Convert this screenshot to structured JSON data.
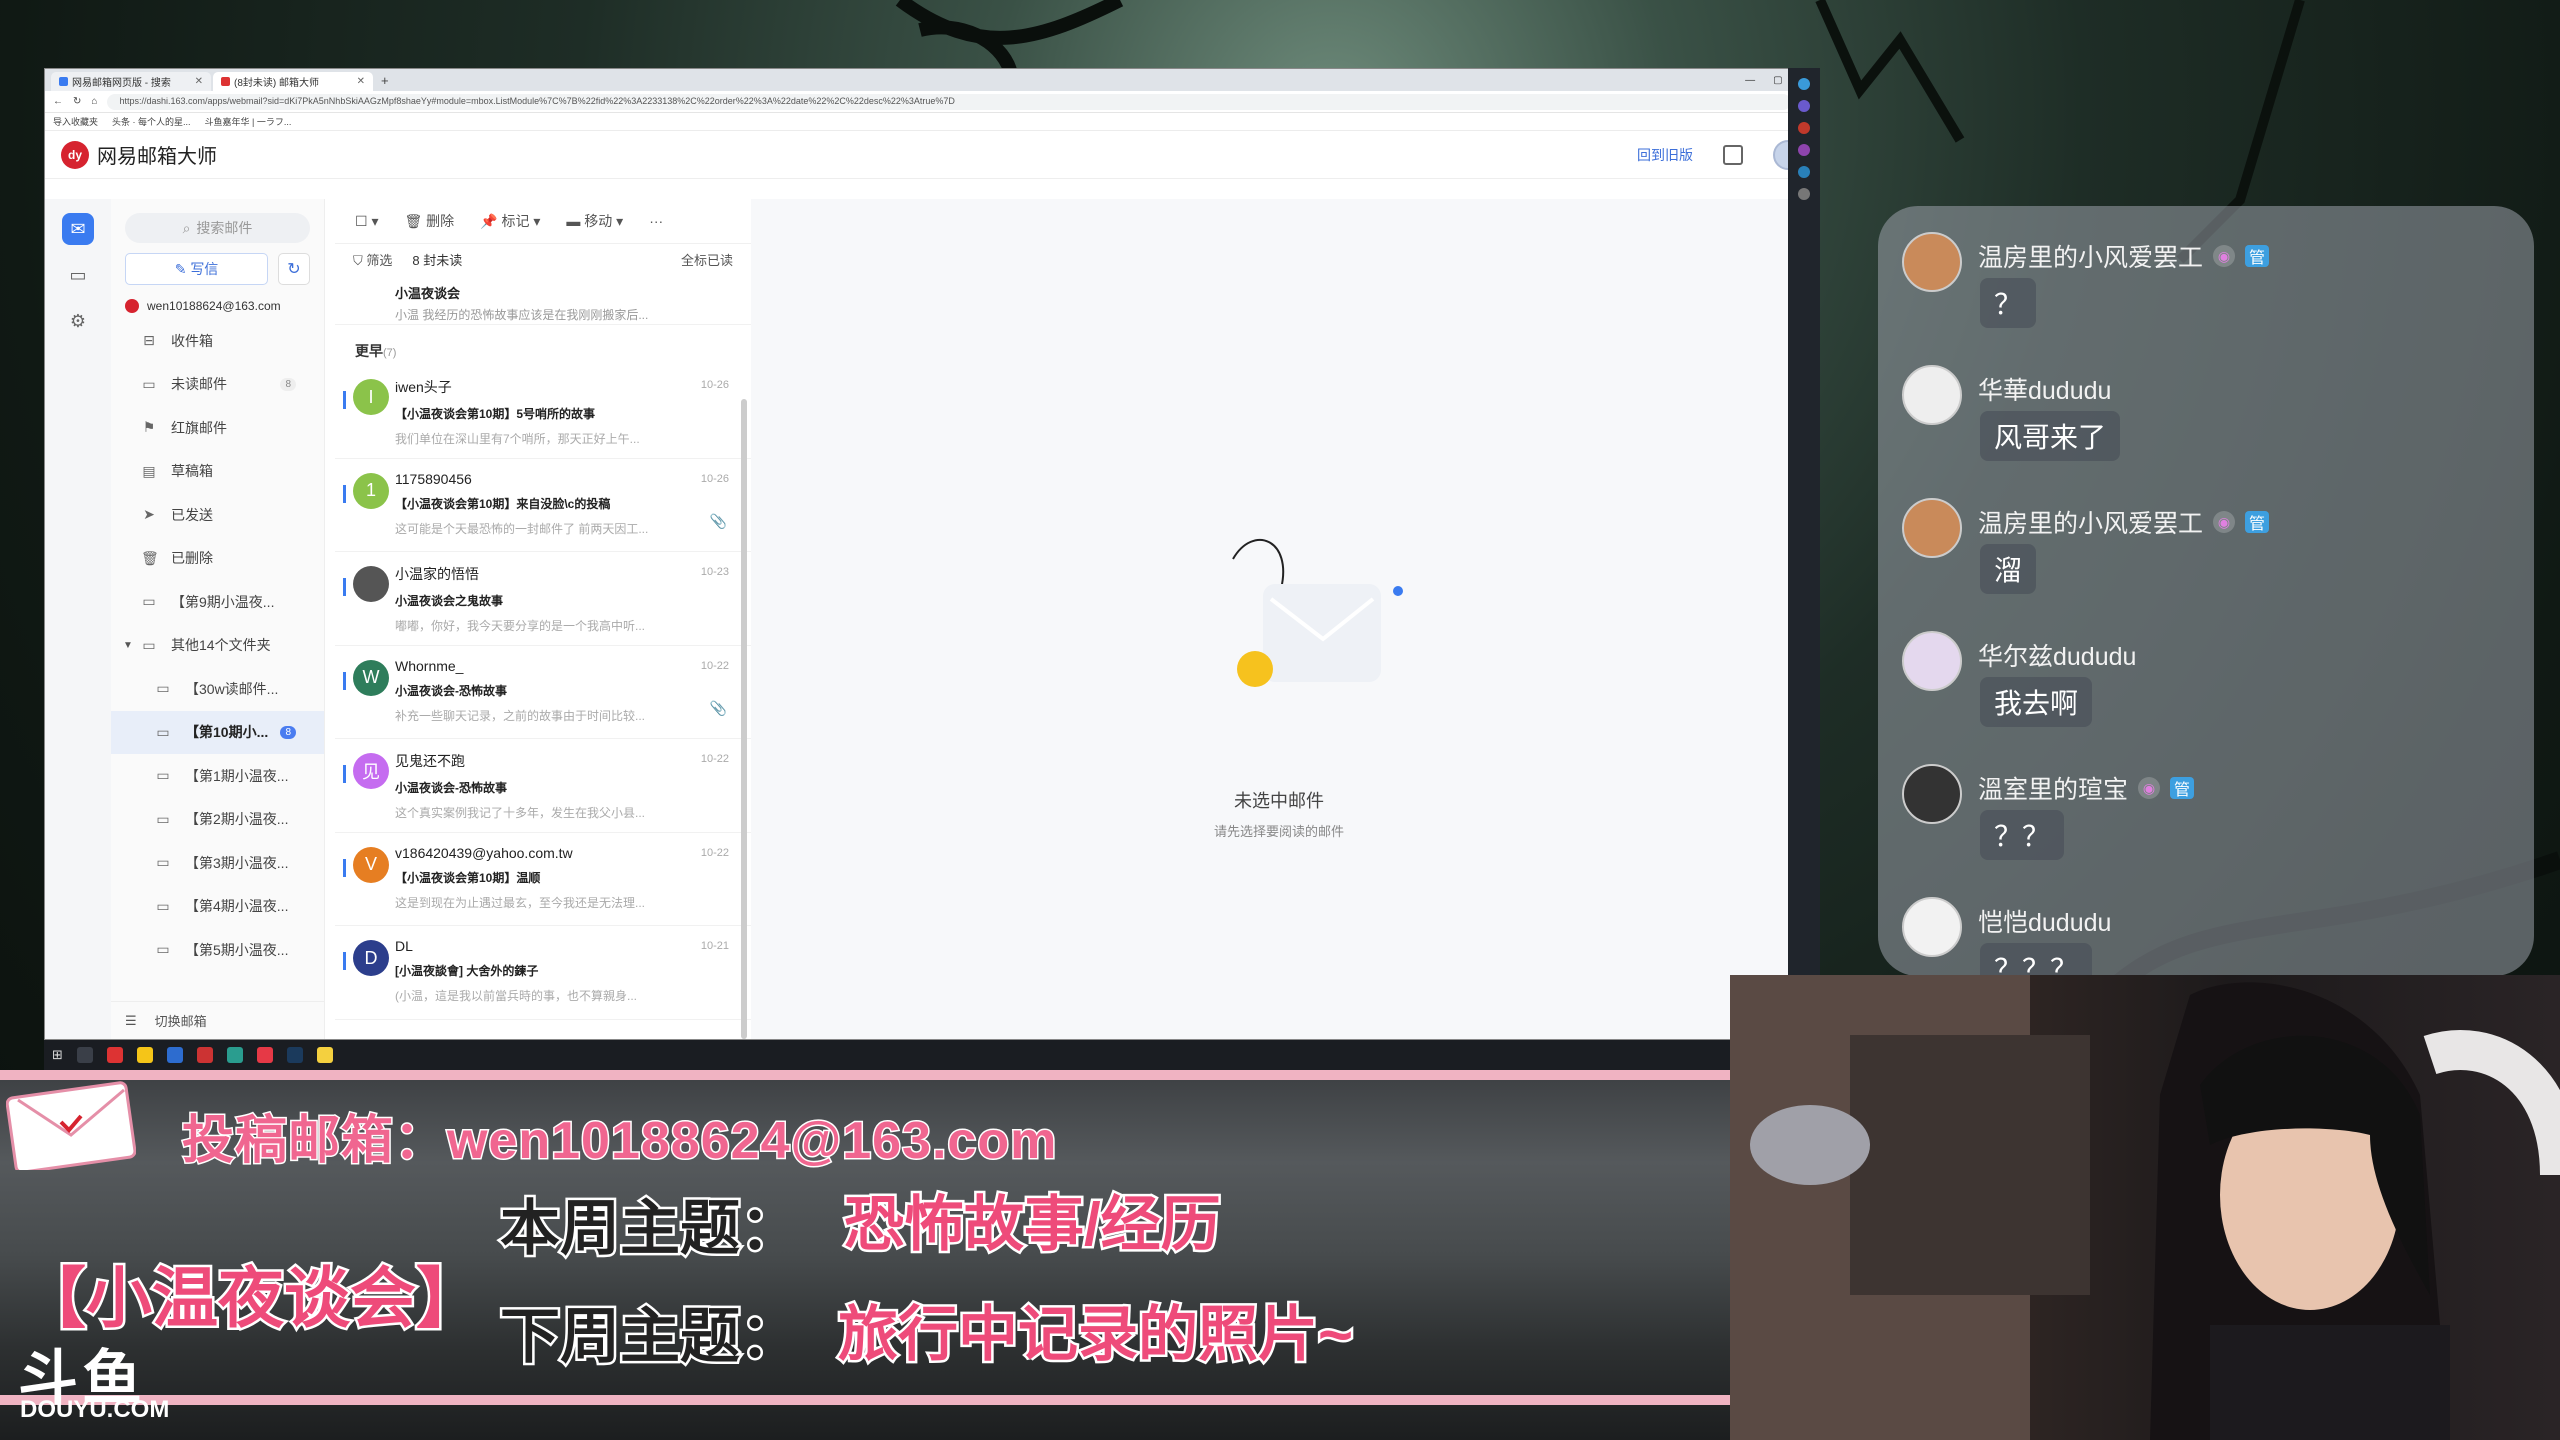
{
  "browser": {
    "tabs": [
      {
        "title": "网易邮箱网页版 - 搜索"
      },
      {
        "title": "(8封未读) 邮箱大师"
      }
    ],
    "new_tab": "+",
    "url": "https://dashi.163.com/apps/webmail?sid=dKi7PkA5nNhbSkiAAGzMpf8shaeYy#module=mbox.ListModule%7C%7B%22fid%22%3A2233138%2C%22order%22%3A%22date%22%2C%22desc%22%3Atrue%7D",
    "bookmarks": [
      "导入收藏夹",
      "头条 · 每个人的星...",
      "斗鱼嘉年华 | 一ラフ..."
    ]
  },
  "app": {
    "logo_text": "dy",
    "brand": "网易邮箱大师",
    "old_version_link": "回到旧版",
    "search_placeholder": "搜索邮件",
    "write_label": "写信",
    "account": "wen10188624@163.com",
    "folders": [
      {
        "label": "收件箱",
        "icon": "inbox-icon"
      },
      {
        "label": "未读邮件",
        "icon": "folder-icon",
        "count": "8"
      },
      {
        "label": "红旗邮件",
        "icon": "flag-icon"
      },
      {
        "label": "草稿箱",
        "icon": "draft-icon"
      },
      {
        "label": "已发送",
        "icon": "send-icon"
      },
      {
        "label": "已删除",
        "icon": "trash-icon"
      },
      {
        "label": "【第9期小温夜...",
        "icon": "folder-icon"
      },
      {
        "label": "其他14个文件夹",
        "icon": "folder-icon"
      },
      {
        "label": "【30w读邮件...",
        "icon": "folder-icon"
      },
      {
        "label": "【第10期小...",
        "icon": "folder-icon",
        "count": "8"
      },
      {
        "label": "【第1期小温夜...",
        "icon": "folder-icon"
      },
      {
        "label": "【第2期小温夜...",
        "icon": "folder-icon"
      },
      {
        "label": "【第3期小温夜...",
        "icon": "folder-icon"
      },
      {
        "label": "【第4期小温夜...",
        "icon": "folder-icon"
      },
      {
        "label": "【第5期小温夜...",
        "icon": "folder-icon"
      }
    ],
    "switch_account": "切换邮箱",
    "toolbar": {
      "delete": "删除",
      "mark": "标记",
      "move": "移动",
      "more": "···"
    },
    "filter": {
      "filter": "筛选",
      "unread": "8 封未读",
      "mark_all_read": "全标已读"
    },
    "peek_mail": {
      "subject": "小温夜谈会",
      "preview": "小温 我经历的恐怖故事应该是在我刚刚搬家后..."
    },
    "group_label": "更早",
    "group_count": "(7)",
    "mails": [
      {
        "initial": "I",
        "color": "#8bc34a",
        "from": "iwen头子",
        "date": "10-26",
        "subject": "【小温夜谈会第10期】5号哨所的故事",
        "preview": "我们单位在深山里有7个哨所，那天正好上午...",
        "attachment": false
      },
      {
        "initial": "1",
        "color": "#8bc34a",
        "from": "1175890456",
        "date": "10-26",
        "subject": "【小温夜谈会第10期】来自没脸\\c的投稿",
        "preview": "这可能是个天最恐怖的一封邮件了 前两天因工...",
        "attachment": true
      },
      {
        "initial": "",
        "color": "#555555",
        "from": "小温家的悟悟",
        "date": "10-23",
        "subject": "小温夜谈会之鬼故事",
        "preview": "嘟嘟，你好，我今天要分享的是一个我高中听...",
        "attachment": false
      },
      {
        "initial": "W",
        "color": "#2e7d5b",
        "from": "Whornme_",
        "date": "10-22",
        "subject": "小温夜谈会-恐怖故事",
        "preview": "补充一些聊天记录，之前的故事由于时间比较...",
        "attachment": true
      },
      {
        "initial": "见",
        "color": "#c56cf0",
        "from": "见鬼还不跑",
        "date": "10-22",
        "subject": "小温夜谈会-恐怖故事",
        "preview": "这个真实案例我记了十多年，发生在我父小县...",
        "attachment": false
      },
      {
        "initial": "V",
        "color": "#e67e22",
        "from": "v186420439@yahoo.com.tw",
        "date": "10-22",
        "subject": "【小温夜谈会第10期】温顺",
        "preview": "这是到现在为止遇过最玄，至今我还是无法理...",
        "attachment": false
      },
      {
        "initial": "D",
        "color": "#2c3e8c",
        "from": "DL",
        "date": "10-21",
        "subject": "[小温夜談會] 大舍外的鍊子",
        "preview": "(小温，這是我以前當兵時的事，也不算親身...",
        "attachment": false
      }
    ],
    "empty_title": "未选中邮件",
    "empty_subtitle": "请先选择要阅读的邮件"
  },
  "chat": {
    "messages": [
      {
        "user": "温房里的小风爱罢工",
        "badges": [
          "管"
        ],
        "text": "？"
      },
      {
        "user": "华華dududu",
        "badges": [],
        "text": "风哥来了"
      },
      {
        "user": "温房里的小风爱罢工",
        "badges": [
          "管"
        ],
        "text": "溜"
      },
      {
        "user": "华尔兹dududu",
        "badges": [],
        "text": "我去啊"
      },
      {
        "user": "溫室里的瑄宝",
        "badges": [
          "管"
        ],
        "text": "？？"
      },
      {
        "user": "恺恺dududu",
        "badges": [],
        "text": "？？？"
      }
    ]
  },
  "overlay": {
    "email_line": "投稿邮箱：wen10188624@163.com",
    "this_week_label": "本周主题：",
    "this_week_topic": "恐怖故事/经历",
    "next_week_label": "下周主题：",
    "next_week_topic": "旅行中记录的照片~",
    "show_title": "【小温夜谈会】",
    "platform": "斗鱼",
    "platform_url": "DOUYU.COM"
  }
}
